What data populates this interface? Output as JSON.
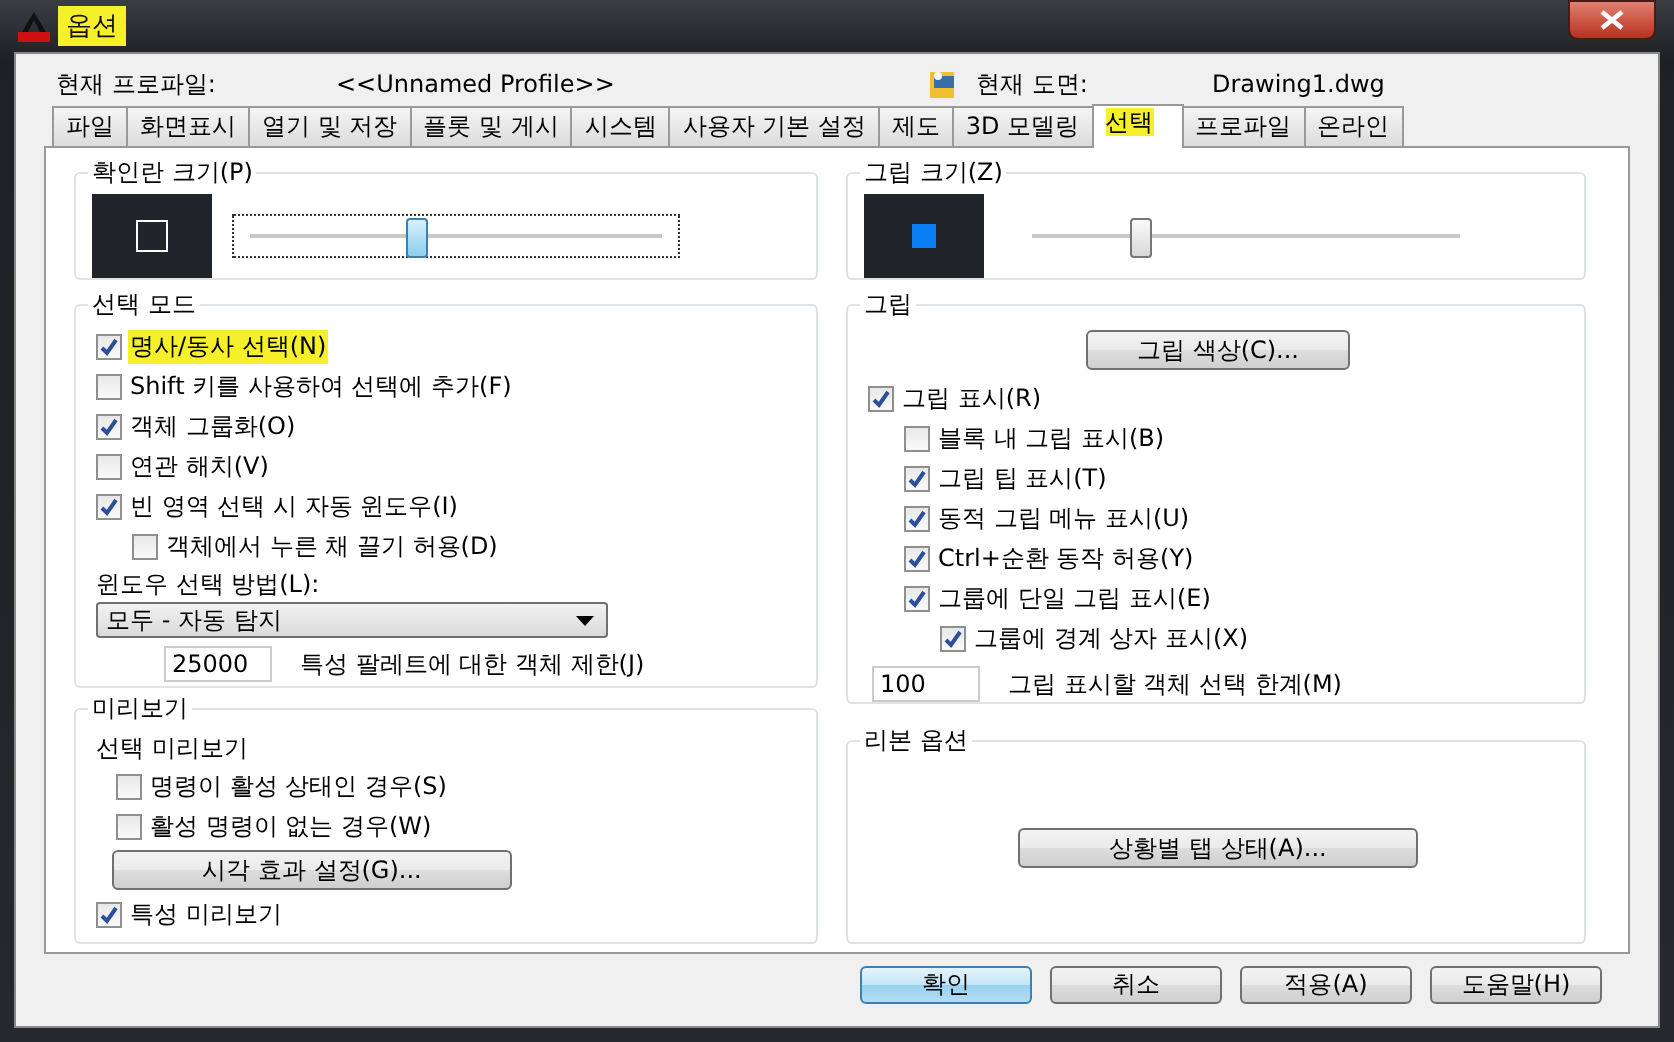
{
  "window": {
    "title": "옵션",
    "title_highlighted": true
  },
  "profile": {
    "label": "현재 프로파일:",
    "value": "<<Unnamed Profile>>",
    "drawing_label": "현재 도면:",
    "drawing_value": "Drawing1.dwg"
  },
  "tabs": [
    {
      "label": "파일",
      "selected": false
    },
    {
      "label": "화면표시",
      "selected": false
    },
    {
      "label": "열기 및 저장",
      "selected": false
    },
    {
      "label": "플롯 및 게시",
      "selected": false
    },
    {
      "label": "시스템",
      "selected": false
    },
    {
      "label": "사용자 기본 설정",
      "selected": false
    },
    {
      "label": "제도",
      "selected": false
    },
    {
      "label": "3D 모델링",
      "selected": false
    },
    {
      "label": "선택",
      "selected": true
    },
    {
      "label": "프로파일",
      "selected": false
    },
    {
      "label": "온라인",
      "selected": false
    }
  ],
  "pickbox_size": {
    "title": "확인란 크기(P)",
    "level": 0.41
  },
  "selection_mode": {
    "title": "선택 모드",
    "options": [
      {
        "label": "명사/동사 선택(N)",
        "checked": true,
        "highlighted": true
      },
      {
        "label": "Shift 키를 사용하여 선택에 추가(F)",
        "checked": false,
        "highlighted": false
      },
      {
        "label": "객체 그룹화(O)",
        "checked": true,
        "highlighted": false
      },
      {
        "label": "연관 해치(V)",
        "checked": false,
        "highlighted": false
      },
      {
        "label": "빈 영역 선택 시 자동 윈도우(I)",
        "checked": true,
        "highlighted": false,
        "children": [
          {
            "label": "객체에서 누른 채 끌기 허용(D)",
            "checked": false,
            "highlighted": false
          }
        ]
      }
    ],
    "window_method_label": "윈도우 선택 방법(L):",
    "window_method_value": "모두 - 자동 탐지",
    "limit_value": "25000",
    "limit_label": "특성 팔레트에 대한 객체 제한(J)"
  },
  "preview": {
    "title": "미리보기",
    "subtitle": "선택 미리보기",
    "options": [
      {
        "label": "명령이 활성 상태인 경우(S)",
        "checked": false
      },
      {
        "label": "활성 명령이 없는 경우(W)",
        "checked": false
      }
    ],
    "button": "시각 효과 설정(G)...",
    "property_preview": {
      "label": "특성 미리보기",
      "checked": true
    }
  },
  "grip_size": {
    "title": "그립 크기(Z)",
    "level": 0.27
  },
  "grips": {
    "title": "그립",
    "button": "그립 색상(C)...",
    "options": [
      {
        "label": "그립 표시(R)",
        "checked": true,
        "children": [
          {
            "label": "블록 내 그립 표시(B)",
            "checked": false
          },
          {
            "label": "그립 팁 표시(T)",
            "checked": true
          },
          {
            "label": "동적 그립 메뉴 표시(U)",
            "checked": true
          },
          {
            "label": "Ctrl+순환 동작 허용(Y)",
            "checked": true
          },
          {
            "label": "그룹에 단일 그립 표시(E)",
            "checked": true,
            "children": [
              {
                "label": "그룹에 경계 상자 표시(X)",
                "checked": true
              }
            ]
          }
        ]
      }
    ],
    "limit_value": "100",
    "limit_label": "그립 표시할 객체 선택 한계(M)"
  },
  "ribbon": {
    "title": "리본 옵션",
    "button": "상황별 탭 상태(A)..."
  },
  "buttons": [
    {
      "label": "확인",
      "default": true
    },
    {
      "label": "취소",
      "default": false
    },
    {
      "label": "적용(A)",
      "default": false
    },
    {
      "label": "도움말(H)",
      "default": false
    }
  ]
}
